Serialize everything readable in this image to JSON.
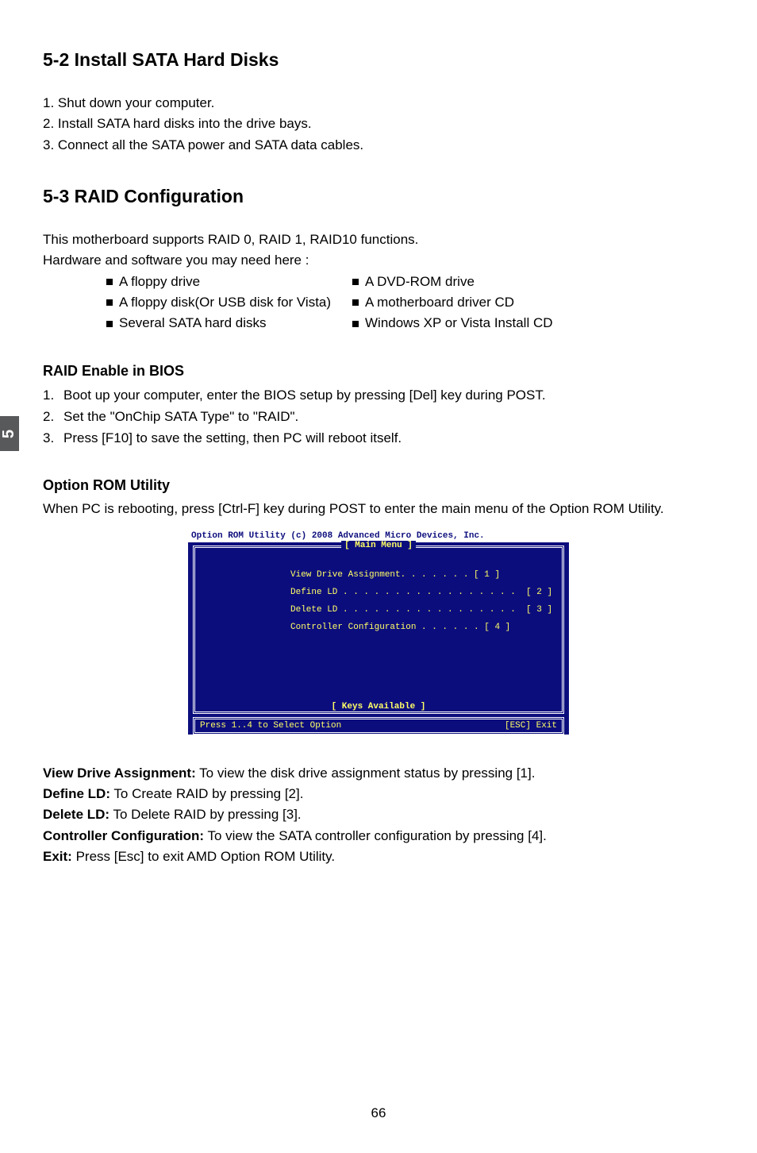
{
  "side_tab": "5",
  "page_number": "66",
  "section52": {
    "heading": "5-2 Install SATA Hard Disks",
    "steps": [
      "1. Shut down your computer.",
      "2. Install SATA hard disks into the drive bays.",
      "3. Connect all the SATA power and SATA data cables."
    ]
  },
  "section53": {
    "heading": "5-3 RAID Configuration",
    "intro1": "This motherboard supports RAID 0, RAID 1, RAID10 functions.",
    "intro2": "Hardware and software you may need here :",
    "col1": [
      "A floppy drive",
      "A floppy disk(Or USB disk for Vista)",
      "Several SATA hard disks"
    ],
    "col2": [
      "A DVD-ROM drive",
      "A motherboard driver CD",
      "Windows XP or Vista Install CD"
    ]
  },
  "raid_enable": {
    "heading": "RAID Enable in BIOS",
    "steps": [
      {
        "num": "1.",
        "text": "Boot up your computer, enter the BIOS setup by pressing [Del] key during POST."
      },
      {
        "num": "2.",
        "text": "Set the \"OnChip SATA Type\" to \"RAID\"."
      },
      {
        "num": "3.",
        "text": "Press [F10] to save the setting, then PC will reboot itself."
      }
    ]
  },
  "option_rom": {
    "heading": "Option ROM Utility",
    "intro": "When PC is rebooting, press [Ctrl-F] key during POST to enter the main menu of the Option ROM Utility."
  },
  "bios": {
    "title": "Option ROM Utility (c) 2008 Advanced Micro Devices, Inc.",
    "main_menu_label": "[ Main Menu ]",
    "menu_items": [
      "View Drive Assignment. . . . . . . [ 1 ]",
      "Define LD . . . . . . . . . . . . . . . . .  [ 2 ]",
      "Delete LD . . . . . . . . . . . . . . . . .  [ 3 ]",
      "Controller Configuration . . . . . . [ 4 ]"
    ],
    "keys_label": "[ Keys Available ]",
    "keys_left": "Press 1..4 to Select Option",
    "keys_right": "[ESC] Exit"
  },
  "definitions": [
    {
      "label": "View Drive Assignment:",
      "text": " To view the disk drive assignment status by pressing [1]."
    },
    {
      "label": "Define LD:",
      "text": " To Create RAID by pressing [2]."
    },
    {
      "label": "Delete LD:",
      "text": " To Delete RAID by pressing [3]."
    },
    {
      "label": "Controller Configuration:",
      "text": " To view the SATA controller configuration by pressing [4]."
    },
    {
      "label": "Exit:",
      "text": " Press [Esc] to exit AMD Option ROM Utility."
    }
  ]
}
